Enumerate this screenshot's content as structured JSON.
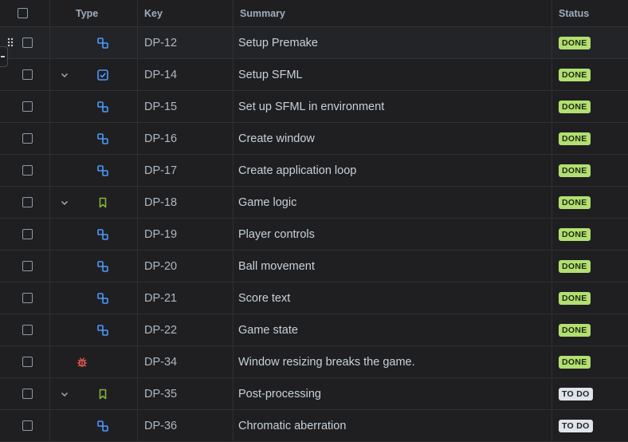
{
  "columns": {
    "type": "Type",
    "key": "Key",
    "summary": "Summary",
    "status": "Status"
  },
  "rows": [
    {
      "key": "DP-12",
      "summary": "Setup Premake",
      "status": "DONE",
      "type": "subtask",
      "indent": 1
    },
    {
      "key": "DP-14",
      "summary": "Setup SFML",
      "status": "DONE",
      "type": "task",
      "indent": 0
    },
    {
      "key": "DP-15",
      "summary": "Set up SFML in environment",
      "status": "DONE",
      "type": "subtask",
      "indent": 1
    },
    {
      "key": "DP-16",
      "summary": "Create window",
      "status": "DONE",
      "type": "subtask",
      "indent": 1
    },
    {
      "key": "DP-17",
      "summary": "Create application loop",
      "status": "DONE",
      "type": "subtask",
      "indent": 1
    },
    {
      "key": "DP-18",
      "summary": "Game logic",
      "status": "DONE",
      "type": "story",
      "indent": 0
    },
    {
      "key": "DP-19",
      "summary": "Player controls",
      "status": "DONE",
      "type": "subtask",
      "indent": 1
    },
    {
      "key": "DP-20",
      "summary": "Ball movement",
      "status": "DONE",
      "type": "subtask",
      "indent": 1
    },
    {
      "key": "DP-21",
      "summary": "Score text",
      "status": "DONE",
      "type": "subtask",
      "indent": 1
    },
    {
      "key": "DP-22",
      "summary": "Game state",
      "status": "DONE",
      "type": "subtask",
      "indent": 1
    },
    {
      "key": "DP-34",
      "summary": "Window resizing breaks the game.",
      "status": "DONE",
      "type": "bug",
      "indent": 0
    },
    {
      "key": "DP-35",
      "summary": "Post-processing",
      "status": "TO DO",
      "type": "story",
      "indent": 0
    },
    {
      "key": "DP-36",
      "summary": "Chromatic aberration",
      "status": "TO DO",
      "type": "subtask",
      "indent": 1
    }
  ],
  "colors": {
    "subtask": "#4c9aff",
    "task": "#4c9aff",
    "story": "#82b536",
    "bug": "#f15b50",
    "done_badge": "#b3df72",
    "todo_badge": "#dee4ea"
  }
}
